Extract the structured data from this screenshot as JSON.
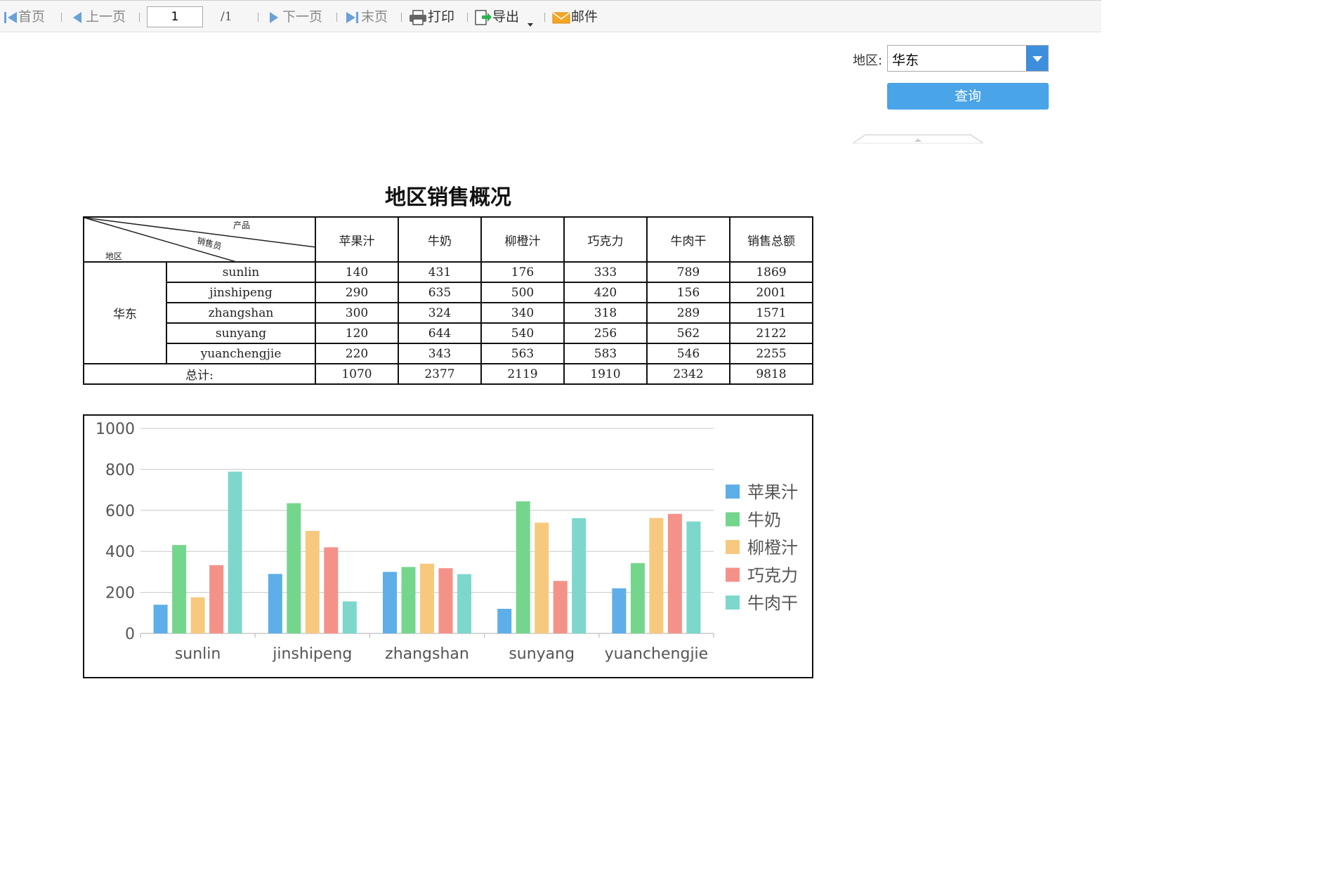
{
  "toolbar": {
    "first": "首页",
    "prev": "上一页",
    "page_input": "1",
    "page_total": "/1",
    "next": "下一页",
    "last": "末页",
    "print": "打印",
    "export": "导出",
    "mail": "邮件"
  },
  "query": {
    "region_label": "地区:",
    "region_value": "华东",
    "query_button": "查询"
  },
  "report": {
    "title": "地区销售概况",
    "header_corner": {
      "product": "产品",
      "salesperson": "销售员",
      "region": "地区"
    },
    "columns": [
      "苹果汁",
      "牛奶",
      "柳橙汁",
      "巧克力",
      "牛肉干",
      "销售总额"
    ],
    "region": "华东",
    "rows": [
      {
        "name": "sunlin",
        "values": [
          "140",
          "431",
          "176",
          "333",
          "789",
          "1869"
        ]
      },
      {
        "name": "jinshipeng",
        "values": [
          "290",
          "635",
          "500",
          "420",
          "156",
          "2001"
        ]
      },
      {
        "name": "zhangshan",
        "values": [
          "300",
          "324",
          "340",
          "318",
          "289",
          "1571"
        ]
      },
      {
        "name": "sunyang",
        "values": [
          "120",
          "644",
          "540",
          "256",
          "562",
          "2122"
        ]
      },
      {
        "name": "yuanchengjie",
        "values": [
          "220",
          "343",
          "563",
          "583",
          "546",
          "2255"
        ]
      }
    ],
    "total_label": "总计:",
    "totals": [
      "1070",
      "2377",
      "2119",
      "1910",
      "2342",
      "9818"
    ]
  },
  "chart_data": {
    "type": "bar",
    "categories": [
      "sunlin",
      "jinshipeng",
      "zhangshan",
      "sunyang",
      "yuanchengjie"
    ],
    "series": [
      {
        "name": "苹果汁",
        "color": "#5eaee9",
        "values": [
          140,
          290,
          300,
          120,
          220
        ]
      },
      {
        "name": "牛奶",
        "color": "#74d68d",
        "values": [
          431,
          635,
          324,
          644,
          343
        ]
      },
      {
        "name": "柳橙汁",
        "color": "#f7c97e",
        "values": [
          176,
          500,
          340,
          540,
          563
        ]
      },
      {
        "name": "巧克力",
        "color": "#f4928a",
        "values": [
          333,
          420,
          318,
          256,
          583
        ]
      },
      {
        "name": "牛肉干",
        "color": "#7dd7cc",
        "values": [
          789,
          156,
          289,
          562,
          546
        ]
      }
    ],
    "yticks": [
      "0",
      "200",
      "400",
      "600",
      "800",
      "1000"
    ],
    "ylim": [
      0,
      1000
    ],
    "legend": "right",
    "grid": true
  },
  "colors": {
    "accent": "#4aa4e8",
    "select_button": "#3d8fde"
  }
}
